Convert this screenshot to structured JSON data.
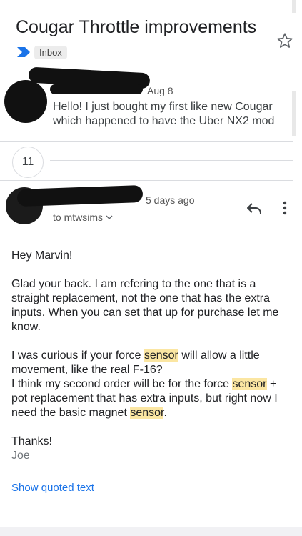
{
  "subject": "Cougar Throttle improvements",
  "label": "Inbox",
  "message1": {
    "date": "Aug 8",
    "snippet": "Hello! I just bought my first like new Cougar which happened to have the Uber NX2 mod"
  },
  "collapsed_count": "11",
  "message2": {
    "date": "5 days ago",
    "to": "to mtwsims",
    "greeting": "Hey Marvin!",
    "p1": "Glad your back. I am refering to the one that is a straight replacement, not the one that has the extra inputs. When you can set that up for purchase let me know.",
    "p2_a": "I was curious if your force ",
    "highlight_word": "sensor",
    "p2_b": " will allow a little movement, like the real F-16?",
    "p3_a": "I think my second order will be for the force ",
    "p3_b": " + pot replacement that has extra inputs, but right now I need the basic magnet ",
    "p3_c": ".",
    "thanks": "Thanks!",
    "signature": "Joe"
  },
  "show_quoted": "Show quoted text",
  "colors": {
    "accent": "#1a73e8",
    "highlight": "#fbe6a2",
    "label_arrow": "#1a73e8"
  }
}
